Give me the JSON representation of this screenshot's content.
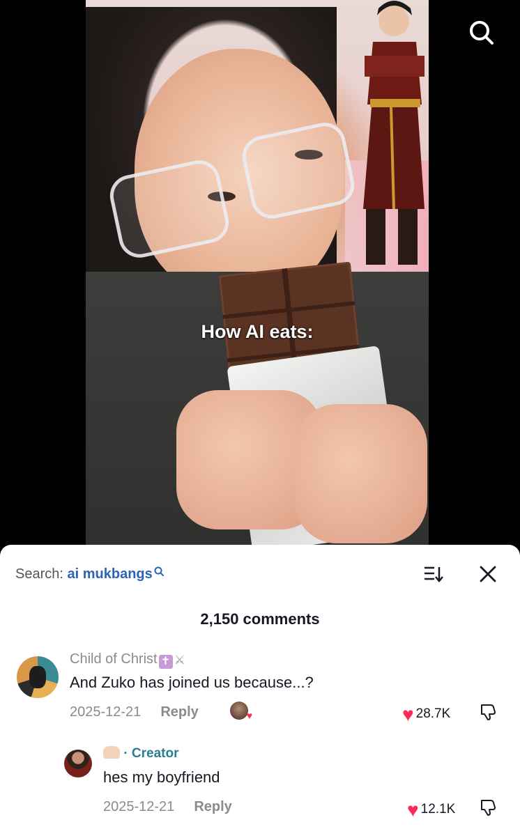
{
  "video": {
    "caption": "How AI eats:"
  },
  "icons": {
    "top_search": "search-icon",
    "sort": "sort-icon",
    "close": "close-icon",
    "like": "heart-icon",
    "dislike": "dislike-icon"
  },
  "colors": {
    "like_red": "#fe2c55",
    "search_query_blue": "#2c63b8",
    "creator_teal": "#2a7f8e"
  },
  "comments_panel": {
    "search_prefix": "Search:",
    "search_query": "ai mukbangs",
    "count_label": "2,150 comments"
  },
  "comments": [
    {
      "username": "Child of Christ",
      "text": "And Zuko has joined us because...?",
      "date": "2025-12-21",
      "reply_label": "Reply",
      "likes": "28.7K"
    },
    {
      "badge": "· Creator",
      "text": "hes my boyfriend",
      "date": "2025-12-21",
      "reply_label": "Reply",
      "likes": "12.1K"
    }
  ]
}
